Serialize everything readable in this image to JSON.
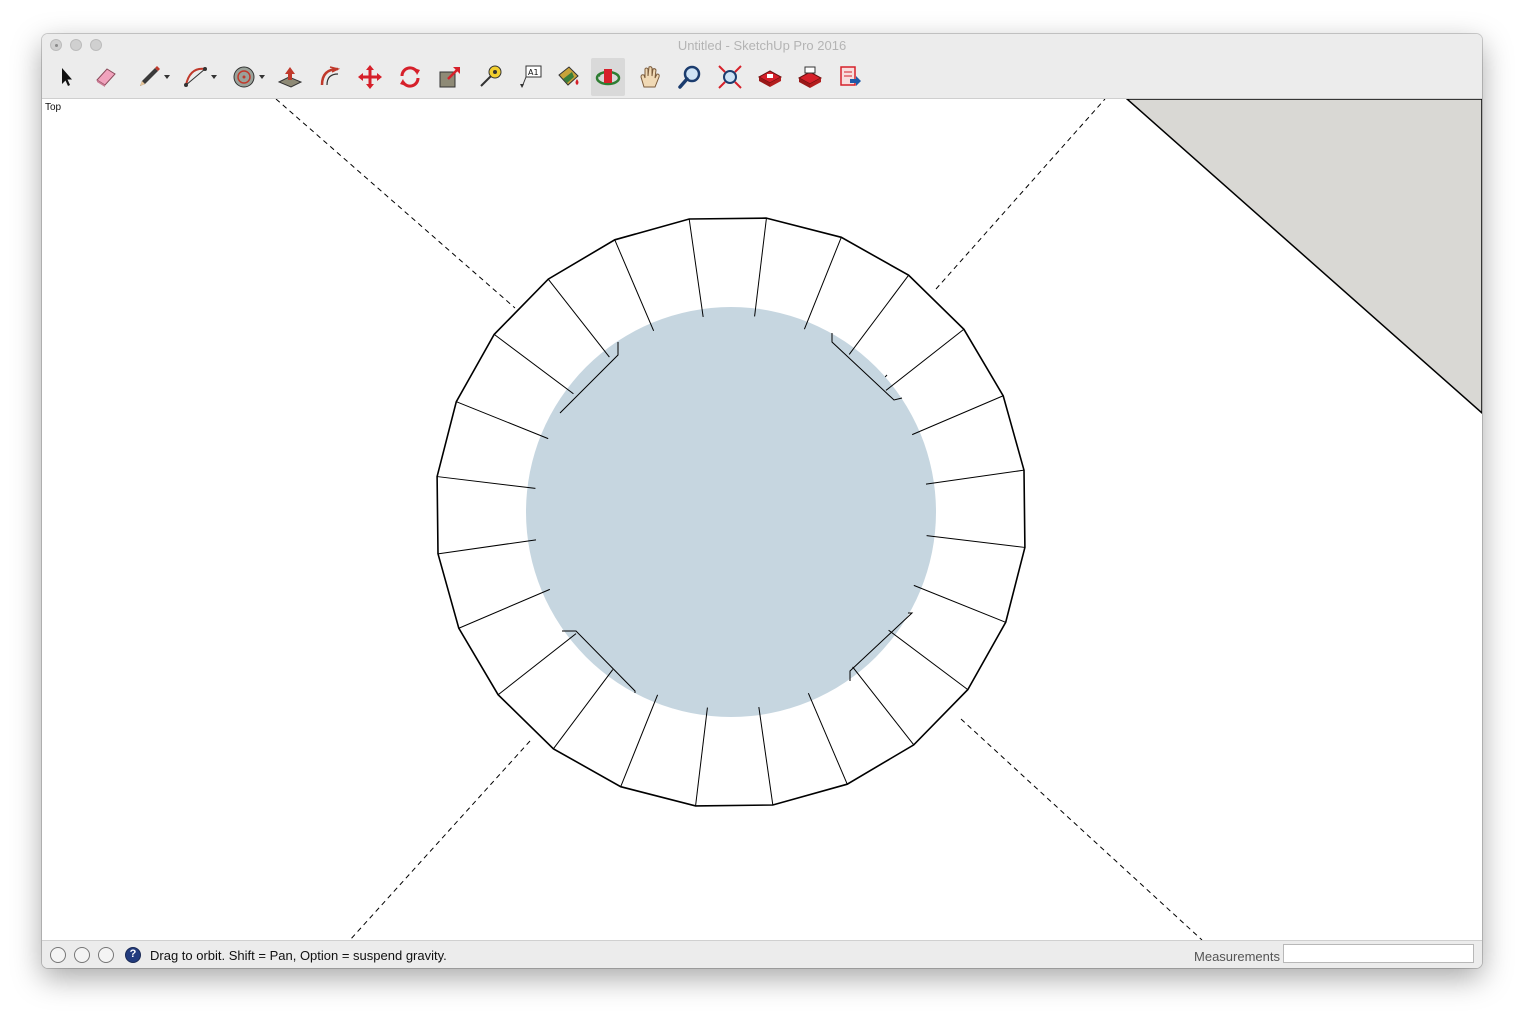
{
  "window": {
    "title": "Untitled - SketchUp Pro 2016"
  },
  "toolbar": {
    "tools": [
      {
        "id": "select",
        "icon": "select-arrow-icon"
      },
      {
        "id": "eraser",
        "icon": "eraser-icon"
      },
      {
        "id": "line",
        "icon": "pencil-icon",
        "has_menu": true
      },
      {
        "id": "arc",
        "icon": "arc-icon",
        "has_menu": true
      },
      {
        "id": "shapes",
        "icon": "circle-shape-icon",
        "has_menu": true
      },
      {
        "id": "push-pull",
        "icon": "push-pull-icon"
      },
      {
        "id": "offset",
        "icon": "offset-icon"
      },
      {
        "id": "move",
        "icon": "move-icon"
      },
      {
        "id": "rotate",
        "icon": "rotate-icon"
      },
      {
        "id": "scale",
        "icon": "scale-icon"
      },
      {
        "id": "tape-measure",
        "icon": "tape-measure-icon"
      },
      {
        "id": "text",
        "icon": "text-label-icon",
        "label": "A1"
      },
      {
        "id": "paint-bucket",
        "icon": "paint-bucket-icon"
      },
      {
        "id": "orbit",
        "icon": "orbit-icon",
        "active": true
      },
      {
        "id": "pan",
        "icon": "hand-icon"
      },
      {
        "id": "zoom",
        "icon": "magnifier-icon"
      },
      {
        "id": "zoom-extents",
        "icon": "zoom-extents-icon"
      },
      {
        "id": "warehouse",
        "icon": "3d-warehouse-icon"
      },
      {
        "id": "extension-warehouse",
        "icon": "extension-warehouse-icon"
      },
      {
        "id": "send-to-layout",
        "icon": "send-to-layout-icon"
      }
    ]
  },
  "viewport": {
    "view_name": "Top",
    "segments": 24,
    "colors": {
      "disk": "#c6d6e0",
      "ground": "#d9d8d4",
      "edge": "#000000",
      "background": "#ffffff"
    }
  },
  "status": {
    "message": "Drag to orbit. Shift = Pan, Option = suspend gravity.",
    "measurements_label": "Measurements",
    "measurements_value": ""
  }
}
